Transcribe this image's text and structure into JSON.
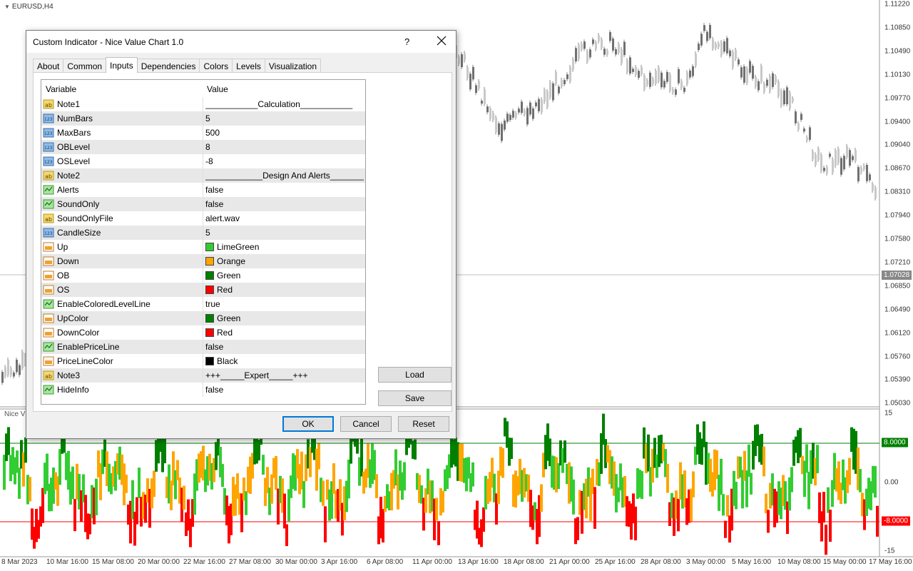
{
  "chart": {
    "symbol": "EURUSD,H4",
    "current_price": "1.07028",
    "price_axis": [
      "1.11220",
      "1.10850",
      "1.10490",
      "1.10130",
      "1.09770",
      "1.09400",
      "1.09040",
      "1.08670",
      "1.08310",
      "1.07940",
      "1.07580",
      "1.07210",
      "1.06850",
      "1.06490",
      "1.06120",
      "1.05760",
      "1.05390",
      "1.05030"
    ],
    "indicator_title": "Nice V",
    "indicator_axis": [
      "15",
      "8.0000",
      "0.00",
      "-8.0000",
      "-15"
    ],
    "date_axis": [
      "8 Mar 2023",
      "10 Mar 16:00",
      "15 Mar 08:00",
      "20 Mar 00:00",
      "22 Mar 16:00",
      "27 Mar 08:00",
      "30 Mar 00:00",
      "3 Apr 16:00",
      "6 Apr 08:00",
      "11 Apr 00:00",
      "13 Apr 16:00",
      "18 Apr 08:00",
      "21 Apr 00:00",
      "25 Apr 16:00",
      "28 Apr 08:00",
      "3 May 00:00",
      "5 May 16:00",
      "10 May 08:00",
      "15 May 00:00",
      "17 May 16:00"
    ],
    "colors": {
      "up": "#32cd32",
      "down": "#ffa500",
      "ob": "#008000",
      "os": "#ff0000",
      "ob_line": "#008000",
      "os_line": "#ff0000",
      "price_tag": "#888888"
    },
    "ob_level": 8,
    "os_level": -8
  },
  "dialog": {
    "title": "Custom Indicator - Nice Value Chart 1.0",
    "help_label": "?",
    "tabs": [
      {
        "label": "About"
      },
      {
        "label": "Common"
      },
      {
        "label": "Inputs",
        "active": true
      },
      {
        "label": "Dependencies"
      },
      {
        "label": "Colors"
      },
      {
        "label": "Levels"
      },
      {
        "label": "Visualization"
      }
    ],
    "grid": {
      "col_variable": "Variable",
      "col_value": "Value",
      "rows": [
        {
          "icon": "ab",
          "name": "Note1",
          "value": "___________Calculation___________"
        },
        {
          "icon": "123",
          "name": "NumBars",
          "value": "5"
        },
        {
          "icon": "123",
          "name": "MaxBars",
          "value": "500"
        },
        {
          "icon": "123",
          "name": "OBLevel",
          "value": "8"
        },
        {
          "icon": "123",
          "name": "OSLevel",
          "value": "-8"
        },
        {
          "icon": "ab",
          "name": "Note2",
          "value": "____________Design And Alerts__________..."
        },
        {
          "icon": "bool",
          "name": "Alerts",
          "value": "false"
        },
        {
          "icon": "bool",
          "name": "SoundOnly",
          "value": "false"
        },
        {
          "icon": "ab",
          "name": "SoundOnlyFile",
          "value": "alert.wav"
        },
        {
          "icon": "123",
          "name": "CandleSize",
          "value": "5"
        },
        {
          "icon": "color",
          "name": "Up",
          "value": "LimeGreen",
          "swatch": "#32cd32"
        },
        {
          "icon": "color",
          "name": "Down",
          "value": "Orange",
          "swatch": "#ffa500"
        },
        {
          "icon": "color",
          "name": "OB",
          "value": "Green",
          "swatch": "#008000"
        },
        {
          "icon": "color",
          "name": "OS",
          "value": "Red",
          "swatch": "#ff0000"
        },
        {
          "icon": "bool",
          "name": "EnableColoredLevelLine",
          "value": "true"
        },
        {
          "icon": "color",
          "name": "UpColor",
          "value": "Green",
          "swatch": "#008000"
        },
        {
          "icon": "color",
          "name": "DownColor",
          "value": "Red",
          "swatch": "#ff0000"
        },
        {
          "icon": "bool",
          "name": "EnablePriceLine",
          "value": "false"
        },
        {
          "icon": "color",
          "name": "PriceLineColor",
          "value": "Black",
          "swatch": "#000000"
        },
        {
          "icon": "ab",
          "name": "Note3",
          "value": "+++_____Expert_____+++"
        },
        {
          "icon": "bool",
          "name": "HideInfo",
          "value": "false"
        }
      ]
    },
    "buttons": {
      "load": "Load",
      "save": "Save",
      "ok": "OK",
      "cancel": "Cancel",
      "reset": "Reset"
    }
  }
}
